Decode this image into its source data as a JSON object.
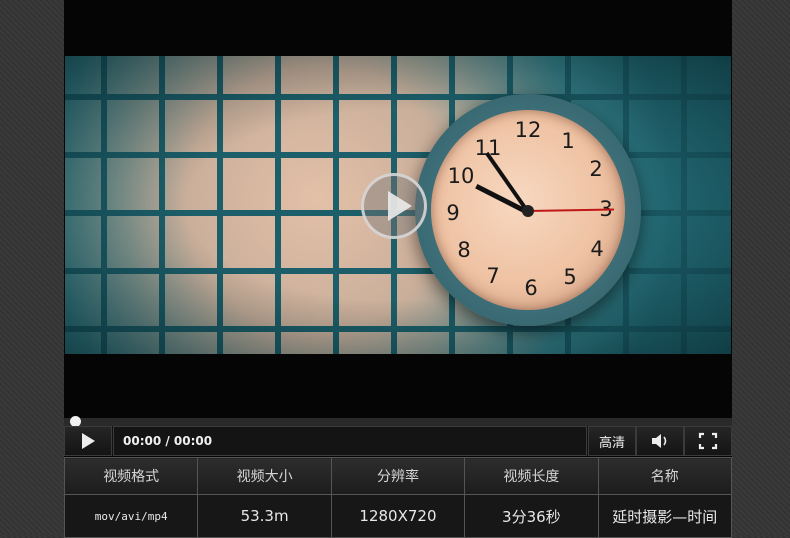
{
  "video": {
    "clock_numbers": [
      "12",
      "1",
      "2",
      "3",
      "4",
      "5",
      "6",
      "7",
      "8",
      "9",
      "10",
      "11"
    ],
    "big_play_icon": "play-circle-icon"
  },
  "controls": {
    "play_icon": "play-icon",
    "time": "00:00 / 00:00",
    "hd_label": "高清",
    "volume_icon": "speaker-icon",
    "fullscreen_icon": "fullscreen-icon",
    "progress": 0
  },
  "info": {
    "headers": [
      "视频格式",
      "视频大小",
      "分辨率",
      "视频长度",
      "名称"
    ],
    "values": [
      "mov/avi/mp4",
      "53.3m",
      "1280X720",
      "3分36秒",
      "延时摄影—时间"
    ]
  },
  "colors": {
    "player_bg": "#050505",
    "clock_face": "#efc2a3",
    "tile_teal": "#256f7a",
    "second_hand": "#c01818"
  }
}
